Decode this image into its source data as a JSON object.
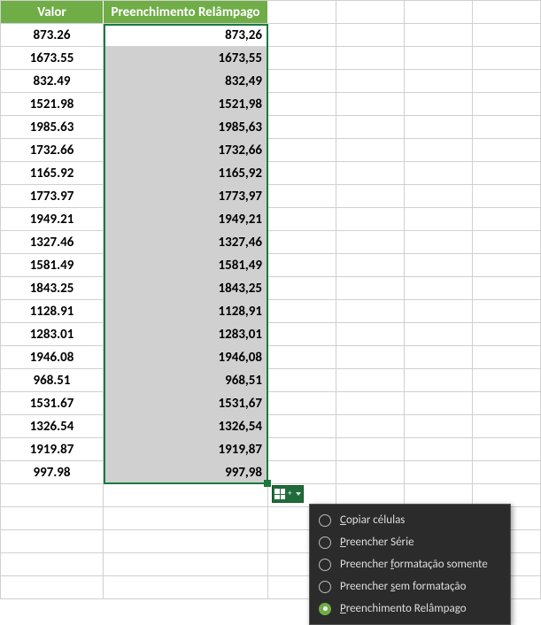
{
  "headers": {
    "col_a": "Valor",
    "col_b": "Preenchimento Relâmpago"
  },
  "rows": [
    {
      "valor": "873.26",
      "fill": "873,26"
    },
    {
      "valor": "1673.55",
      "fill": "1673,55"
    },
    {
      "valor": "832.49",
      "fill": "832,49"
    },
    {
      "valor": "1521.98",
      "fill": "1521,98"
    },
    {
      "valor": "1985.63",
      "fill": "1985,63"
    },
    {
      "valor": "1732.66",
      "fill": "1732,66"
    },
    {
      "valor": "1165.92",
      "fill": "1165,92"
    },
    {
      "valor": "1773.97",
      "fill": "1773,97"
    },
    {
      "valor": "1949.21",
      "fill": "1949,21"
    },
    {
      "valor": "1327.46",
      "fill": "1327,46"
    },
    {
      "valor": "1581.49",
      "fill": "1581,49"
    },
    {
      "valor": "1843.25",
      "fill": "1843,25"
    },
    {
      "valor": "1128.91",
      "fill": "1128,91"
    },
    {
      "valor": "1283.01",
      "fill": "1283,01"
    },
    {
      "valor": "1946.08",
      "fill": "1946,08"
    },
    {
      "valor": "968.51",
      "fill": "968,51"
    },
    {
      "valor": "1531.67",
      "fill": "1531,67"
    },
    {
      "valor": "1326.54",
      "fill": "1326,54"
    },
    {
      "valor": "1919.87",
      "fill": "1919,87"
    },
    {
      "valor": "997.98",
      "fill": "997,98"
    }
  ],
  "menu": {
    "items": [
      {
        "pre": "",
        "u": "C",
        "post": "opiar células",
        "selected": false
      },
      {
        "pre": "",
        "u": "P",
        "post": "reencher Série",
        "selected": false
      },
      {
        "pre": "Preencher ",
        "u": "f",
        "post": "ormatação somente",
        "selected": false
      },
      {
        "pre": "Preencher ",
        "u": "s",
        "post": "em formatação",
        "selected": false
      },
      {
        "pre": "",
        "u": "P",
        "post": "reenchimento Relâmpago",
        "selected": true
      }
    ]
  }
}
